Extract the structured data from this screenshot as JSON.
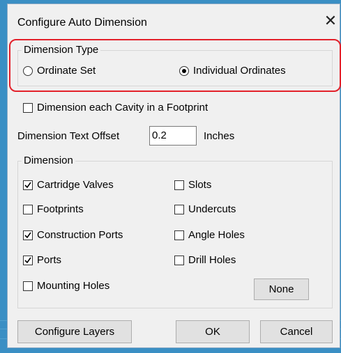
{
  "window": {
    "title": "Configure Auto Dimension",
    "close_glyph": "✕"
  },
  "dimension_type": {
    "label": "Dimension Type",
    "options": [
      {
        "label": "Ordinate Set",
        "selected": false
      },
      {
        "label": "Individual Ordinates",
        "selected": true
      }
    ],
    "highlight_color": "#e3202a"
  },
  "cavity_checkbox": {
    "label": "Dimension each Cavity in a Footprint",
    "checked": false
  },
  "offset": {
    "label": "Dimension Text Offset",
    "value": "0.2",
    "unit": "Inches"
  },
  "dimension_group": {
    "label": "Dimension",
    "left_items": [
      {
        "label": "Cartridge Valves",
        "checked": true
      },
      {
        "label": "Footprints",
        "checked": false
      },
      {
        "label": "Construction Ports",
        "checked": true
      },
      {
        "label": "Ports",
        "checked": true
      },
      {
        "label": "Mounting Holes",
        "checked": false
      }
    ],
    "right_items": [
      {
        "label": "Slots",
        "checked": false
      },
      {
        "label": "Undercuts",
        "checked": false
      },
      {
        "label": "Angle Holes",
        "checked": false
      },
      {
        "label": "Drill Holes",
        "checked": false
      }
    ],
    "none_button": "None"
  },
  "buttons": {
    "configure_layers": "Configure Layers",
    "ok": "OK",
    "cancel": "Cancel"
  }
}
